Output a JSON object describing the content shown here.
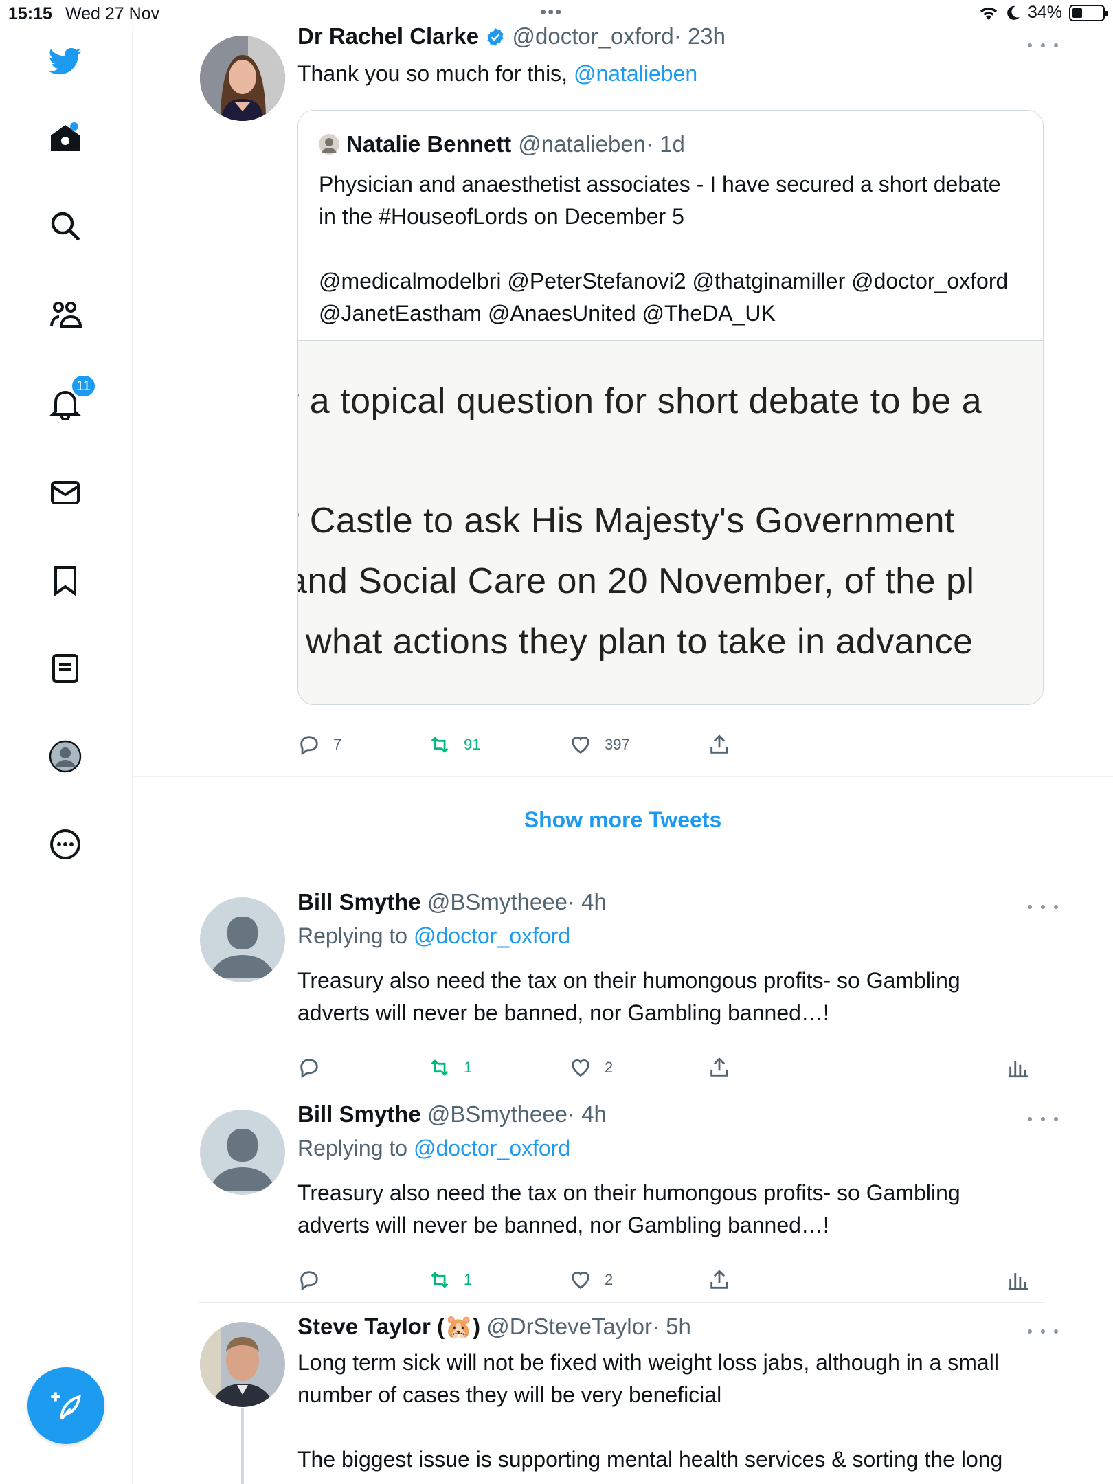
{
  "status_bar": {
    "time": "15:15",
    "date": "Wed 27 Nov",
    "battery": "34%",
    "battery_level": 0.34
  },
  "sidebar": {
    "items": [
      {
        "name": "home",
        "icon": "home-icon"
      },
      {
        "name": "explore",
        "icon": "search-icon"
      },
      {
        "name": "communities",
        "icon": "communities-icon"
      },
      {
        "name": "notifications",
        "icon": "bell-icon",
        "badge": "11"
      },
      {
        "name": "messages",
        "icon": "envelope-icon"
      },
      {
        "name": "bookmarks",
        "icon": "bookmark-icon"
      },
      {
        "name": "lists",
        "icon": "list-icon"
      },
      {
        "name": "profile",
        "icon": "profile-avatar"
      },
      {
        "name": "more",
        "icon": "more-circle-icon"
      }
    ],
    "accent": "#1d9bf0"
  },
  "main_tweet": {
    "name": "Dr Rachel Clarke",
    "handle": "@doctor_oxford",
    "time": "· 23h",
    "text": "Thank you so much for this,",
    "mention": "@natalieben",
    "quote": {
      "name": "Natalie Bennett",
      "handle": "@natalieben",
      "time": "· 1d",
      "text": "Physician and anaesthetist associates - I have secured a short debate in the #HouseofLords on December 5\n\n@medicalmodelbri @PeterStefanovi2 @thatginamiller @doctor_oxford @JanetEastham @AnaesUnited @TheDA_UK",
      "image_lines": [
        "r a topical question for short debate to be a",
        "r Castle to ask His Majesty's Government",
        "and Social Care on 20 November, of the pl",
        "l what actions they plan to take in advance"
      ]
    },
    "replies": "7",
    "retweets": "91",
    "likes": "397"
  },
  "show_more": "Show more Tweets",
  "replies": [
    {
      "name": "Bill Smythe",
      "handle": "@BSmytheee",
      "time": "· 4h",
      "replying_label": "Replying to",
      "replying_to": "@doctor_oxford",
      "text": "Treasury also need the tax on their humongous profits- so Gambling adverts will never be banned, nor Gambling banned…!",
      "retweets": "1",
      "likes": "2"
    },
    {
      "name": "Bill Smythe",
      "handle": "@BSmytheee",
      "time": "· 4h",
      "replying_label": "Replying to",
      "replying_to": "@doctor_oxford",
      "text": "Treasury also need the tax on their humongous profits- so Gambling adverts will never be banned, nor Gambling banned…!",
      "retweets": "1",
      "likes": "2"
    }
  ],
  "last_tweet": {
    "name_prefix": "Steve Taylor (",
    "emoji": "🐹",
    "name_suffix": ")",
    "handle": "@DrSteveTaylor",
    "time": "· 5h",
    "text": "Long term sick will not be fixed with weight loss jabs, although in a small number of cases they will be very beneficial\n\nThe biggest issue is supporting mental health services & sorting the long"
  }
}
